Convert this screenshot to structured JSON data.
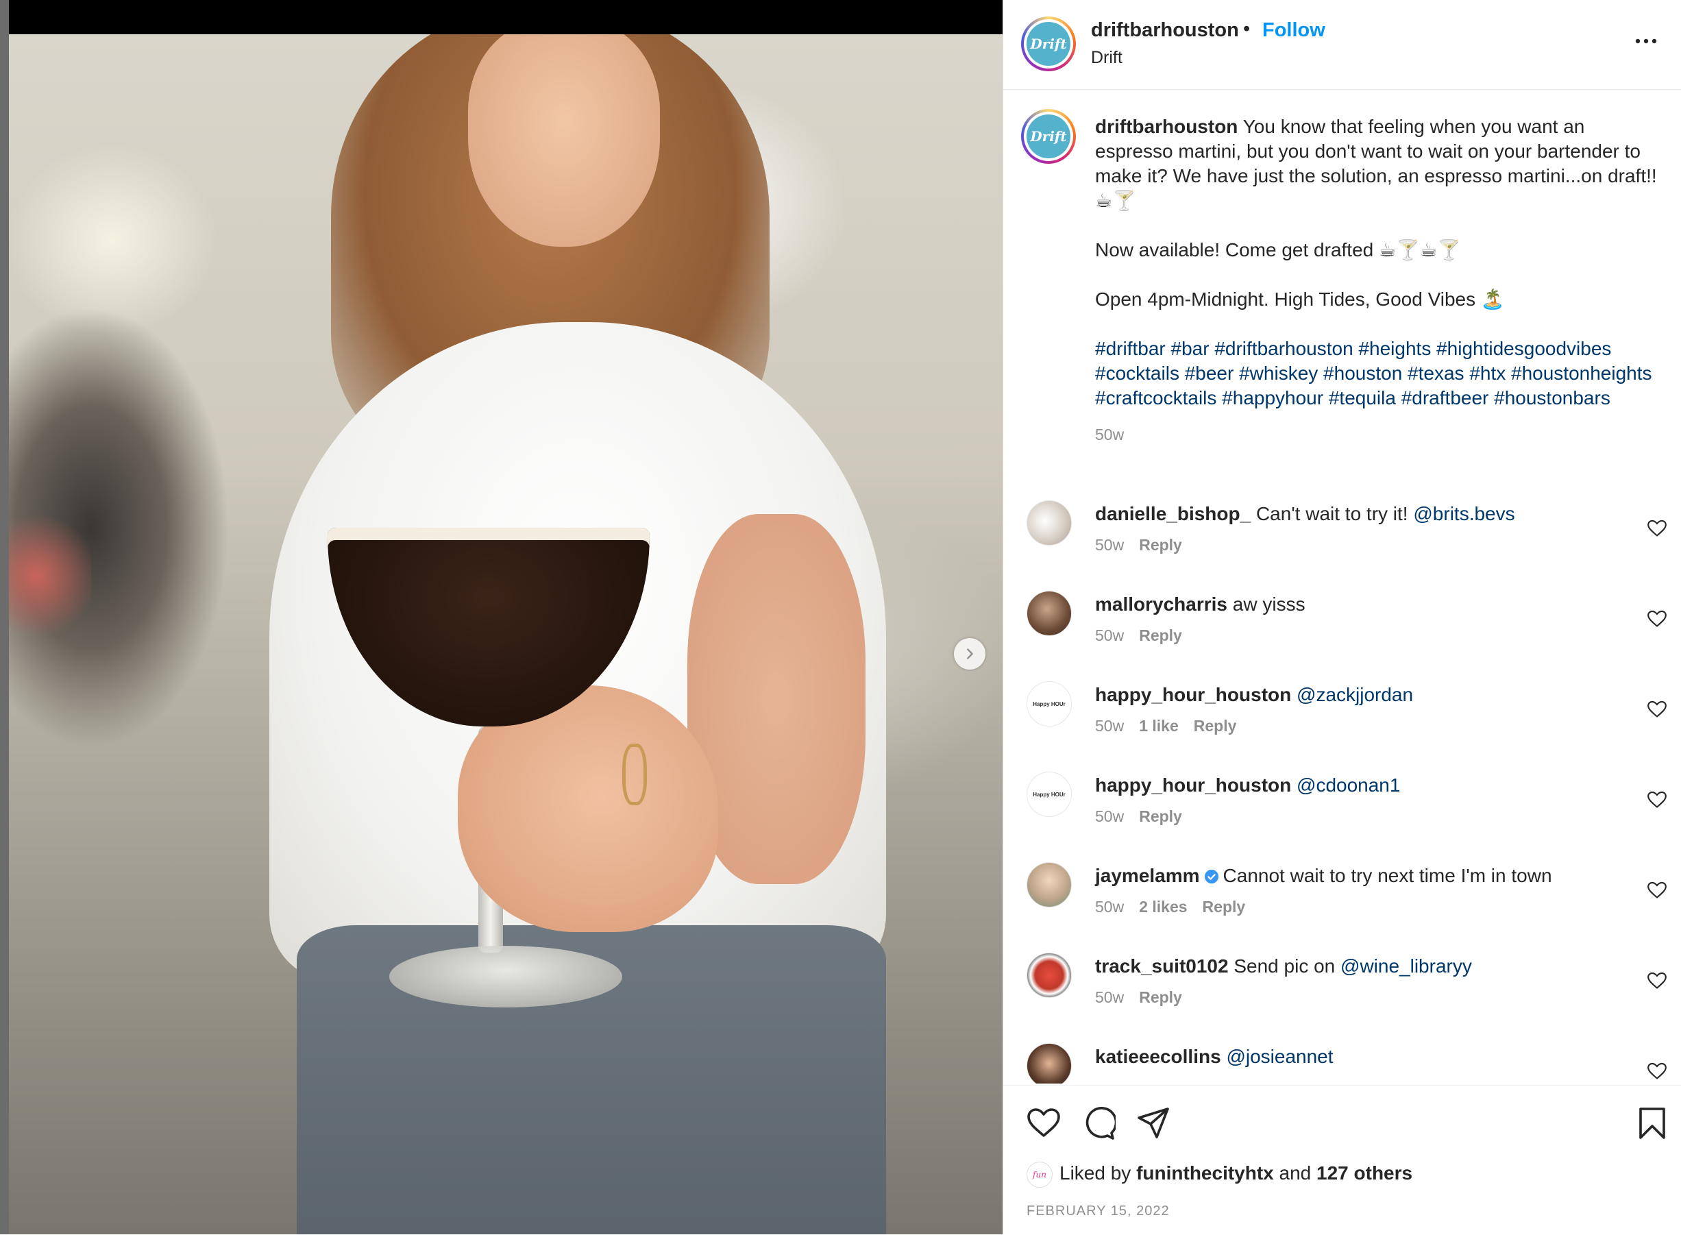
{
  "post": {
    "username": "driftbarhouston",
    "follow_label": "Follow",
    "separator": "•",
    "location": "Drift",
    "logo_text": "Drift"
  },
  "caption": {
    "username": "driftbarhouston",
    "line1": "You know that feeling when you want an espresso martini, but you don't want to wait on your bartender to make it? We have just the solution, an espresso martini...on draft!! ☕🍸",
    "line2": "Now available! Come get drafted ☕🍸☕🍸",
    "line3": "Open 4pm-Midnight. High Tides, Good Vibes 🏝️",
    "hashtags": "#driftbar #bar #driftbarhouston #heights #hightidesgoodvibes #cocktails #beer #whiskey #houston #texas #htx #houstonheights #craftcocktails #happyhour #tequila #draftbeer #houstonbars",
    "time": "50w"
  },
  "comments": [
    {
      "username": "danielle_bishop_",
      "text": "Can't wait to try it!",
      "mention": "@brits.bevs",
      "time": "50w",
      "likes": "",
      "reply": "Reply",
      "avatar_color": "#d7cfc6"
    },
    {
      "username": "mallorycharris",
      "text": "aw yisss",
      "mention": "",
      "time": "50w",
      "likes": "",
      "reply": "Reply",
      "avatar_color": "#6b4a36"
    },
    {
      "username": "happy_hour_houston",
      "text": "",
      "mention": "@zackjjordan",
      "time": "50w",
      "likes": "1 like",
      "reply": "Reply",
      "avatar_color": "#ffffff"
    },
    {
      "username": "happy_hour_houston",
      "text": "",
      "mention": "@cdoonan1",
      "time": "50w",
      "likes": "",
      "reply": "Reply",
      "avatar_color": "#ffffff"
    },
    {
      "username": "jaymelamm",
      "text": "Cannot wait to try next time I'm in town",
      "mention": "",
      "time": "50w",
      "likes": "2 likes",
      "reply": "Reply",
      "avatar_color": "#bfa58a"
    },
    {
      "username": "track_suit0102",
      "text": "Send pic on",
      "mention": "@wine_libraryy",
      "time": "50w",
      "likes": "",
      "reply": "Reply",
      "avatar_color": "#c0392b"
    },
    {
      "username": "katieeecollins",
      "text": "",
      "mention": "@josieannet",
      "time": "",
      "likes": "",
      "reply": "",
      "avatar_color": "#5a3a2a"
    }
  ],
  "hh_avatar_text": "Happy HOUr",
  "footer": {
    "liked_prefix": "Liked by",
    "liked_user": "funinthecityhtx",
    "liked_and": "and",
    "liked_others": "127 others",
    "liked_avatar_text": "fun",
    "date": "FEBRUARY 15, 2022"
  },
  "icons": [
    "next-arrow-icon",
    "more-icon",
    "heart-icon",
    "comment-icon",
    "share-icon",
    "bookmark-icon",
    "verified-icon"
  ],
  "colors": {
    "follow": "#0095f6",
    "link": "#00376b",
    "muted": "#8e8e8e",
    "logo": "#55b2cc"
  }
}
